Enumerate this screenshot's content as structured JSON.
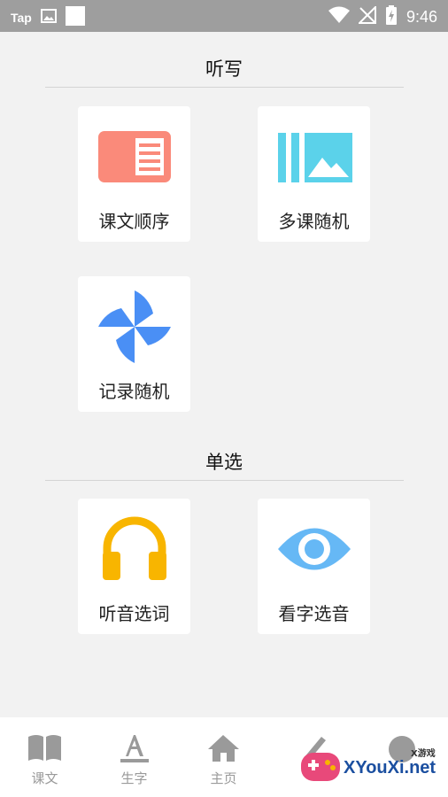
{
  "status_bar": {
    "app_label": "Tap",
    "time": "9:46",
    "icons": [
      "image-icon",
      "square-icon",
      "wifi-icon",
      "no-signal-icon",
      "battery-charging-icon"
    ]
  },
  "sections": [
    {
      "title": "听写",
      "cards": [
        {
          "label": "课文顺序",
          "icon": "document-icon",
          "color": "#fa8a7a"
        },
        {
          "label": "多课随机",
          "icon": "gallery-icon",
          "color": "#5bd2ea"
        },
        {
          "label": "记录随机",
          "icon": "pinwheel-icon",
          "color": "#4a8ff5"
        }
      ]
    },
    {
      "title": "单选",
      "cards": [
        {
          "label": "听音选词",
          "icon": "headphones-icon",
          "color": "#f8b500"
        },
        {
          "label": "看字选音",
          "icon": "eye-icon",
          "color": "#66b8f5"
        }
      ]
    }
  ],
  "bottom_nav": [
    {
      "label": "课文",
      "icon": "book-icon"
    },
    {
      "label": "生字",
      "icon": "letter-a-icon"
    },
    {
      "label": "主页",
      "icon": "home-icon"
    },
    {
      "label": "",
      "icon": "pencil-icon"
    },
    {
      "label": "",
      "icon": "more-icon"
    }
  ],
  "watermark": {
    "text": "XYouXi.net",
    "small": "X游戏"
  },
  "colors": {
    "background": "#f2f2f2",
    "status_bar": "#9e9e9e",
    "nav_inactive": "#9a9a9a"
  }
}
